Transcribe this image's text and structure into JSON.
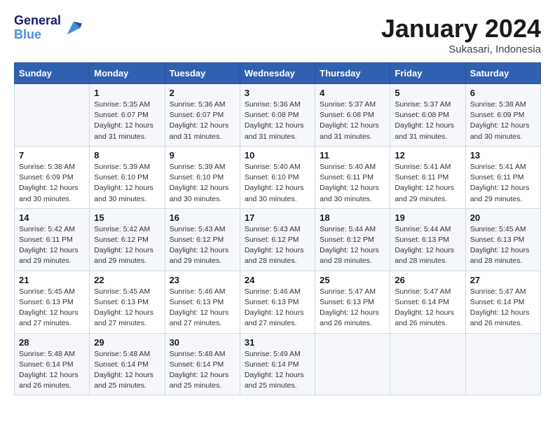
{
  "header": {
    "logo_line1": "General",
    "logo_line2": "Blue",
    "month_title": "January 2024",
    "subtitle": "Sukasari, Indonesia"
  },
  "weekdays": [
    "Sunday",
    "Monday",
    "Tuesday",
    "Wednesday",
    "Thursday",
    "Friday",
    "Saturday"
  ],
  "weeks": [
    [
      {
        "day": "",
        "info": ""
      },
      {
        "day": "1",
        "info": "Sunrise: 5:35 AM\nSunset: 6:07 PM\nDaylight: 12 hours and 31 minutes."
      },
      {
        "day": "2",
        "info": "Sunrise: 5:36 AM\nSunset: 6:07 PM\nDaylight: 12 hours and 31 minutes."
      },
      {
        "day": "3",
        "info": "Sunrise: 5:36 AM\nSunset: 6:08 PM\nDaylight: 12 hours and 31 minutes."
      },
      {
        "day": "4",
        "info": "Sunrise: 5:37 AM\nSunset: 6:08 PM\nDaylight: 12 hours and 31 minutes."
      },
      {
        "day": "5",
        "info": "Sunrise: 5:37 AM\nSunset: 6:08 PM\nDaylight: 12 hours and 31 minutes."
      },
      {
        "day": "6",
        "info": "Sunrise: 5:38 AM\nSunset: 6:09 PM\nDaylight: 12 hours and 30 minutes."
      }
    ],
    [
      {
        "day": "7",
        "info": "Sunrise: 5:38 AM\nSunset: 6:09 PM\nDaylight: 12 hours and 30 minutes."
      },
      {
        "day": "8",
        "info": "Sunrise: 5:39 AM\nSunset: 6:10 PM\nDaylight: 12 hours and 30 minutes."
      },
      {
        "day": "9",
        "info": "Sunrise: 5:39 AM\nSunset: 6:10 PM\nDaylight: 12 hours and 30 minutes."
      },
      {
        "day": "10",
        "info": "Sunrise: 5:40 AM\nSunset: 6:10 PM\nDaylight: 12 hours and 30 minutes."
      },
      {
        "day": "11",
        "info": "Sunrise: 5:40 AM\nSunset: 6:11 PM\nDaylight: 12 hours and 30 minutes."
      },
      {
        "day": "12",
        "info": "Sunrise: 5:41 AM\nSunset: 6:11 PM\nDaylight: 12 hours and 29 minutes."
      },
      {
        "day": "13",
        "info": "Sunrise: 5:41 AM\nSunset: 6:11 PM\nDaylight: 12 hours and 29 minutes."
      }
    ],
    [
      {
        "day": "14",
        "info": "Sunrise: 5:42 AM\nSunset: 6:11 PM\nDaylight: 12 hours and 29 minutes."
      },
      {
        "day": "15",
        "info": "Sunrise: 5:42 AM\nSunset: 6:12 PM\nDaylight: 12 hours and 29 minutes."
      },
      {
        "day": "16",
        "info": "Sunrise: 5:43 AM\nSunset: 6:12 PM\nDaylight: 12 hours and 29 minutes."
      },
      {
        "day": "17",
        "info": "Sunrise: 5:43 AM\nSunset: 6:12 PM\nDaylight: 12 hours and 28 minutes."
      },
      {
        "day": "18",
        "info": "Sunrise: 5:44 AM\nSunset: 6:12 PM\nDaylight: 12 hours and 28 minutes."
      },
      {
        "day": "19",
        "info": "Sunrise: 5:44 AM\nSunset: 6:13 PM\nDaylight: 12 hours and 28 minutes."
      },
      {
        "day": "20",
        "info": "Sunrise: 5:45 AM\nSunset: 6:13 PM\nDaylight: 12 hours and 28 minutes."
      }
    ],
    [
      {
        "day": "21",
        "info": "Sunrise: 5:45 AM\nSunset: 6:13 PM\nDaylight: 12 hours and 27 minutes."
      },
      {
        "day": "22",
        "info": "Sunrise: 5:45 AM\nSunset: 6:13 PM\nDaylight: 12 hours and 27 minutes."
      },
      {
        "day": "23",
        "info": "Sunrise: 5:46 AM\nSunset: 6:13 PM\nDaylight: 12 hours and 27 minutes."
      },
      {
        "day": "24",
        "info": "Sunrise: 5:46 AM\nSunset: 6:13 PM\nDaylight: 12 hours and 27 minutes."
      },
      {
        "day": "25",
        "info": "Sunrise: 5:47 AM\nSunset: 6:13 PM\nDaylight: 12 hours and 26 minutes."
      },
      {
        "day": "26",
        "info": "Sunrise: 5:47 AM\nSunset: 6:14 PM\nDaylight: 12 hours and 26 minutes."
      },
      {
        "day": "27",
        "info": "Sunrise: 5:47 AM\nSunset: 6:14 PM\nDaylight: 12 hours and 26 minutes."
      }
    ],
    [
      {
        "day": "28",
        "info": "Sunrise: 5:48 AM\nSunset: 6:14 PM\nDaylight: 12 hours and 26 minutes."
      },
      {
        "day": "29",
        "info": "Sunrise: 5:48 AM\nSunset: 6:14 PM\nDaylight: 12 hours and 25 minutes."
      },
      {
        "day": "30",
        "info": "Sunrise: 5:48 AM\nSunset: 6:14 PM\nDaylight: 12 hours and 25 minutes."
      },
      {
        "day": "31",
        "info": "Sunrise: 5:49 AM\nSunset: 6:14 PM\nDaylight: 12 hours and 25 minutes."
      },
      {
        "day": "",
        "info": ""
      },
      {
        "day": "",
        "info": ""
      },
      {
        "day": "",
        "info": ""
      }
    ]
  ]
}
